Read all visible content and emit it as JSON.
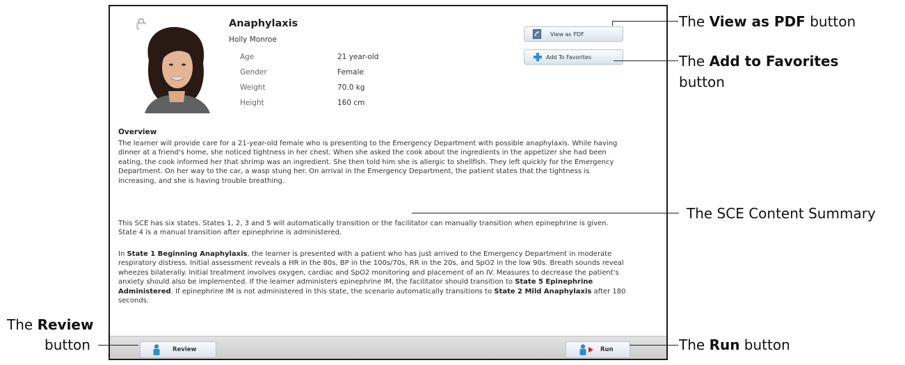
{
  "case": {
    "title": "Anaphylaxis",
    "patient_name": "Holly Monroe",
    "attributes": [
      {
        "label": "Age",
        "value": "21 year-old"
      },
      {
        "label": "Gender",
        "value": "Female"
      },
      {
        "label": "Weight",
        "value": "70.0 kg"
      },
      {
        "label": "Height",
        "value": "160 cm"
      }
    ]
  },
  "buttons": {
    "view_pdf": "View as PDF",
    "add_favorites": "Add To Favorites",
    "review": "Review",
    "run": "Run"
  },
  "overview": {
    "heading": "Overview",
    "p1": "The learner will provide care for a 21-year-old female who is presenting to the Emergency Department with possible anaphylaxis. While having dinner at a friend's home, she noticed tightness in her chest. When she asked the cook about the ingredients in the appetizer she had been eating, the cook informed her that shrimp was an ingredient. She then told him she is allergic to shellfish. They left quickly for the Emergency Department. On her way to the car, a wasp stung her. On arrival in the Emergency Department, the patient states that the tightness is increasing, and she is having trouble breathing.",
    "p2": "This SCE has six states. States 1, 2, 3 and 5 will automatically transition or the facilitator can manually transition when epinephrine is given. State 4 is a manual transition after epinephrine is administered.",
    "p3_a": "In ",
    "p3_b": "State 1 Beginning Anaphylaxis",
    "p3_c": ", the learner is presented with a patient who has just arrived to the Emergency Department in moderate respiratory distress. Initial assessment reveals a HR in the 80s, BP in the 100s/70s, RR in the 20s, and SpO2 in the low 90s. Breath sounds reveal wheezes bilaterally. Initial treatment involves oxygen, cardiac and SpO2 monitoring and placement of an IV. Measures to decrease the patient's anxiety should also be implemented. If the learner administers epinephrine IM, the facilitator should transition to ",
    "p3_d": "State 5 Epinephrine Administered",
    "p3_e": ". If epinephrine IM is not administered in this state, the scenario automatically transitions to ",
    "p3_f": "State 2 Mild Anaphylaxis",
    "p3_g": " after 180 seconds."
  },
  "callouts": {
    "pdf_pre": "The ",
    "pdf_bold": "View as PDF",
    "pdf_post": " button",
    "fav_pre": "The ",
    "fav_bold": "Add to Favorites",
    "fav_post": "button",
    "summary": "The SCE Content Summary",
    "review_pre": "The ",
    "review_bold": "Review",
    "review_post": "button",
    "run_pre": "The ",
    "run_bold": "Run",
    "run_post": " button"
  },
  "colors": {
    "frame_border": "#1b1b1b",
    "button_icon_blue": "#2a8fd0",
    "run_arrow_red": "#d9231f",
    "footer_bar": "#d4d4d4"
  },
  "icons": [
    "lock-icon",
    "pdf-icon",
    "plus-icon",
    "person-icon",
    "play-icon"
  ]
}
